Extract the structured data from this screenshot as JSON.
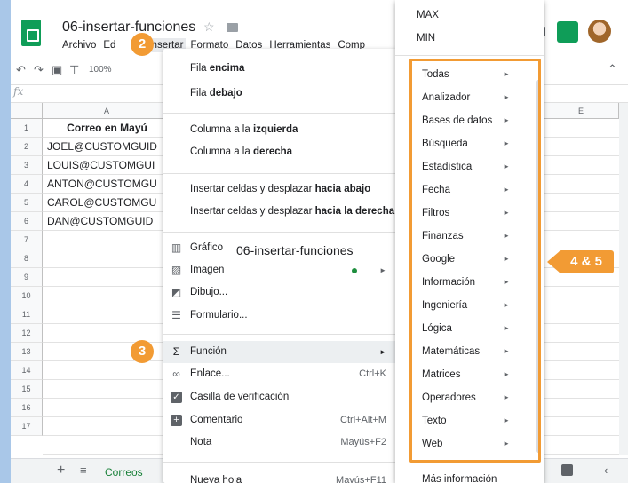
{
  "doc": {
    "title": "06-insertar-funciones"
  },
  "menubar": [
    "Archivo",
    "Ed",
    "Insertar",
    "Formato",
    "Datos",
    "Herramientas",
    "Comp"
  ],
  "toolbar": {
    "zoom": "100%"
  },
  "formula_bar": {
    "fx": "fx"
  },
  "columns": {
    "a": "A",
    "e": "E"
  },
  "rows": [
    "1",
    "2",
    "3",
    "4",
    "5",
    "6",
    "7",
    "8",
    "9",
    "10",
    "11",
    "12",
    "13",
    "14",
    "15",
    "16",
    "17"
  ],
  "cells": {
    "header": "Correo en Mayú",
    "values": [
      "JOEL@CUSTOMGUID",
      "LOUIS@CUSTOMGUI",
      "ANTON@CUSTOMGU",
      "CAROL@CUSTOMGU",
      "DAN@CUSTOMGUID"
    ]
  },
  "insert_menu": {
    "row_above": {
      "pre": "Fila ",
      "bold": "encima"
    },
    "row_below": {
      "pre": "Fila ",
      "bold": "debajo"
    },
    "col_left": {
      "pre": "Columna a la ",
      "bold": "izquierda"
    },
    "col_right": {
      "pre": "Columna a la ",
      "bold": "derecha"
    },
    "cells_down": {
      "pre": "Insertar celdas y desplazar ",
      "bold": "hacia abajo"
    },
    "cells_right": {
      "pre": "Insertar celdas y desplazar ",
      "bold": "hacia la derecha"
    },
    "chart": "Gráfico",
    "image": "Imagen",
    "drawing": "Dibujo...",
    "form": "Formulario...",
    "function": "Función",
    "link": "Enlace...",
    "link_shortcut": "Ctrl+K",
    "checkbox": "Casilla de verificación",
    "comment": "Comentario",
    "comment_shortcut": "Ctrl+Alt+M",
    "note": "Nota",
    "note_shortcut": "Mayús+F2",
    "new_sheet": "Nueva hoja",
    "new_sheet_shortcut": "Mayús+F11"
  },
  "tooltip": "06-insertar-funciones",
  "function_submenu": {
    "top": [
      "MAX",
      "MIN"
    ],
    "categories": [
      "Todas",
      "Analizador",
      "Bases de datos",
      "Búsqueda",
      "Estadística",
      "Fecha",
      "Filtros",
      "Finanzas",
      "Google",
      "Información",
      "Ingeniería",
      "Lógica",
      "Matemáticas",
      "Matrices",
      "Operadores",
      "Texto",
      "Web"
    ],
    "more": "Más información"
  },
  "sheet_tab": "Correos",
  "badges": {
    "step2": "2",
    "step3": "3",
    "step45": "4 & 5"
  },
  "colors": {
    "accent": "#f29b34",
    "sheets_green": "#0f9d58"
  }
}
